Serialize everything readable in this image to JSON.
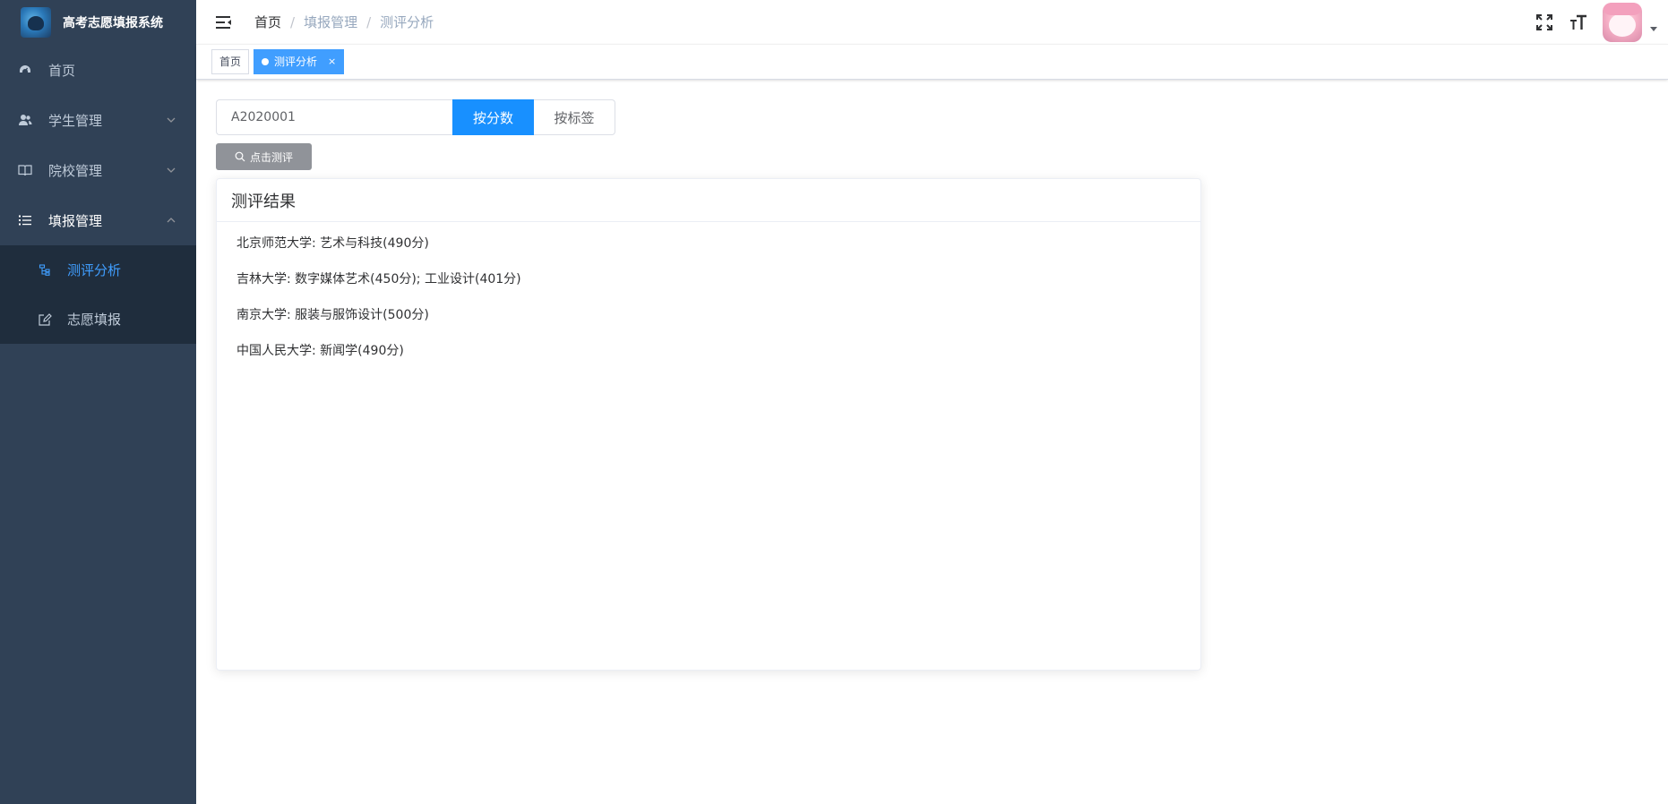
{
  "app": {
    "title": "高考志愿填报系统"
  },
  "sidebar": {
    "items": [
      {
        "label": "首页"
      },
      {
        "label": "学生管理"
      },
      {
        "label": "院校管理"
      },
      {
        "label": "填报管理"
      }
    ],
    "submenu": [
      {
        "label": "测评分析"
      },
      {
        "label": "志愿填报"
      }
    ]
  },
  "breadcrumb": [
    "首页",
    "填报管理",
    "测评分析"
  ],
  "tags": [
    {
      "label": "首页"
    },
    {
      "label": "测评分析",
      "close": "×"
    }
  ],
  "search": {
    "value": "A2020001"
  },
  "segments": {
    "by_score": "按分数",
    "by_tag": "按标签"
  },
  "eval_button": "点击测评",
  "result": {
    "title": "测评结果",
    "lines": [
      "北京师范大学: 艺术与科技(490分)",
      "吉林大学: 数字媒体艺术(450分); 工业设计(401分)",
      "南京大学: 服装与服饰设计(500分)",
      "中国人民大学: 新闻学(490分)"
    ]
  },
  "colors": {
    "sidebar_bg": "#304156",
    "submenu_bg": "#1f2d3d",
    "accent": "#409eff",
    "primary_button": "#1890ff"
  }
}
